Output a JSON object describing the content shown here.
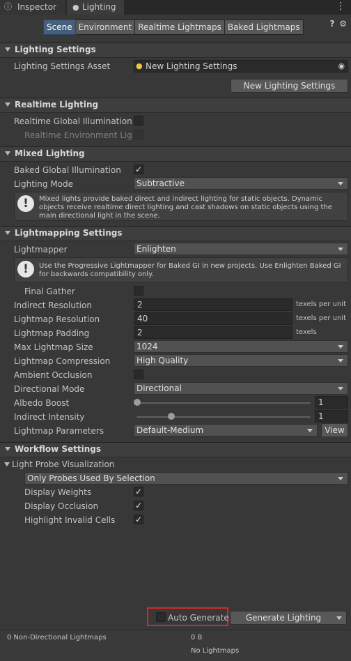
{
  "tabs": {
    "inspector": "Inspector",
    "lighting": "Lighting"
  },
  "toolbar": {
    "segments": [
      "Scene",
      "Environment",
      "Realtime Lightmaps",
      "Baked Lightmaps"
    ]
  },
  "sections": {
    "lighting_settings": {
      "title": "Lighting Settings",
      "asset_label": "Lighting Settings Asset",
      "asset_value": "New Lighting Settings",
      "new_button": "New Lighting Settings"
    },
    "realtime": {
      "title": "Realtime Lighting",
      "gi_label": "Realtime Global Illumination",
      "env_label": "Realtime Environment Lighti"
    },
    "mixed": {
      "title": "Mixed Lighting",
      "baked_gi_label": "Baked Global Illumination",
      "mode_label": "Lighting Mode",
      "mode_value": "Subtractive",
      "help": "Mixed lights provide baked direct and indirect lighting for static objects. Dynamic objects receive realtime direct lighting and cast shadows on static objects using the main directional light in the scene."
    },
    "lightmapping": {
      "title": "Lightmapping Settings",
      "lightmapper_label": "Lightmapper",
      "lightmapper_value": "Enlighten",
      "help": "Use the Progressive Lightmapper for Baked GI in new projects. Use Enlighten Baked GI for backwards compatibility only.",
      "final_gather": "Final Gather",
      "indirect_res_label": "Indirect Resolution",
      "indirect_res_value": "2",
      "indirect_res_unit": "texels per unit",
      "lightmap_res_label": "Lightmap Resolution",
      "lightmap_res_value": "40",
      "lightmap_res_unit": "texels per unit",
      "padding_label": "Lightmap Padding",
      "padding_value": "2",
      "padding_unit": "texels",
      "max_size_label": "Max Lightmap Size",
      "max_size_value": "1024",
      "compression_label": "Lightmap Compression",
      "compression_value": "High Quality",
      "ao_label": "Ambient Occlusion",
      "dir_mode_label": "Directional Mode",
      "dir_mode_value": "Directional",
      "albedo_label": "Albedo Boost",
      "albedo_value": "1",
      "indirect_int_label": "Indirect Intensity",
      "indirect_int_value": "1",
      "params_label": "Lightmap Parameters",
      "params_value": "Default-Medium",
      "view_button": "View"
    },
    "workflow": {
      "title": "Workflow Settings",
      "probe_vis_label": "Light Probe Visualization",
      "probe_vis_value": "Only Probes Used By Selection",
      "display_weights": "Display Weights",
      "display_occlusion": "Display Occlusion",
      "highlight_invalid": "Highlight Invalid Cells"
    }
  },
  "footer": {
    "auto_generate": "Auto Generate",
    "generate_button": "Generate Lighting",
    "stats_label": "0 Non-Directional Lightmaps",
    "stats_size": "0 B",
    "stats_none": "No Lightmaps"
  },
  "colors": {
    "accent": "#46607c",
    "highlight_box": "#d22929"
  },
  "checkmark": "✓"
}
